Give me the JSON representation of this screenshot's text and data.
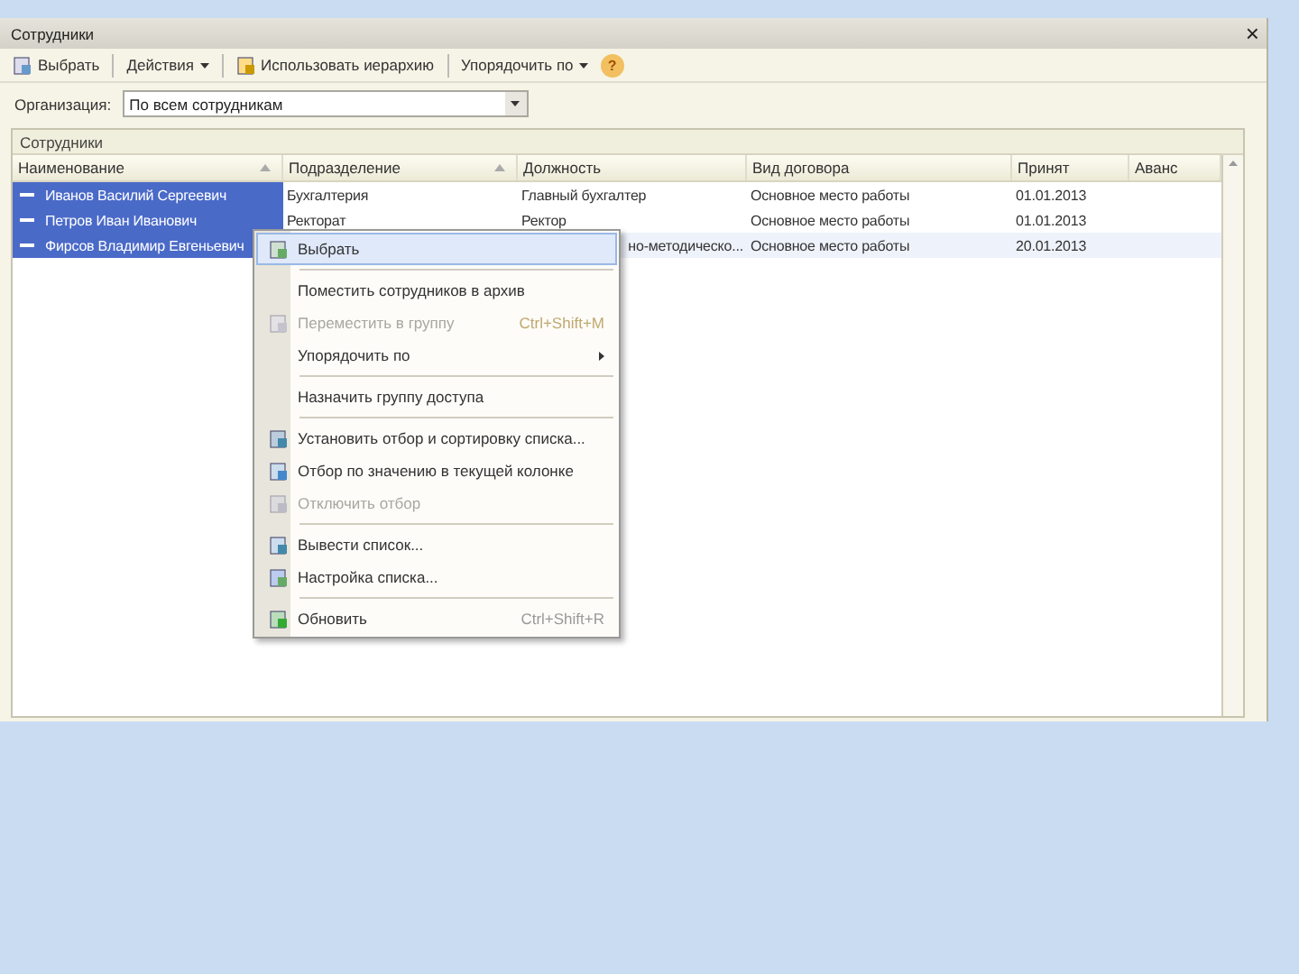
{
  "window": {
    "title": "Сотрудники",
    "close": "×"
  },
  "toolbar": [
    {
      "kind": "icon-button",
      "label": "Выбрать"
    },
    {
      "kind": "dropdown",
      "label": "Действия"
    },
    {
      "kind": "icon-button",
      "label": "Использовать иерархию"
    },
    {
      "kind": "dropdown",
      "label": "Упорядочить по"
    },
    {
      "kind": "help",
      "label": "?"
    }
  ],
  "filter": {
    "label": "Организация:",
    "value": "По всем сотрудникам"
  },
  "panel": {
    "title": "Сотрудники"
  },
  "table": {
    "columns": [
      {
        "label": "Наименование",
        "sortable": true
      },
      {
        "label": "Подразделение",
        "sortable": true
      },
      {
        "label": "Должность",
        "sortable": false
      },
      {
        "label": "Вид договора",
        "sortable": false
      },
      {
        "label": "Принят",
        "sortable": false
      },
      {
        "label": "Аванс",
        "sortable": false
      }
    ],
    "rows": [
      {
        "selected": true,
        "position_cut": false,
        "cells": [
          "Иванов Василий Сергеевич",
          "Бухгалтерия",
          "Главный бухгалтер",
          "Основное место работы",
          "01.01.2013",
          ""
        ]
      },
      {
        "selected": true,
        "position_cut": false,
        "cells": [
          "Петров Иван Иванович",
          "Ректорат",
          "Ректор",
          "Основное место работы",
          "01.01.2013",
          ""
        ]
      },
      {
        "selected": true,
        "position_cut": true,
        "cells": [
          "Фирсов Владимир Евгеньевич",
          "",
          "но-методическо...",
          "Основное место работы",
          "20.01.2013",
          ""
        ]
      }
    ]
  },
  "context_menu": [
    {
      "kind": "item",
      "label": "Выбрать",
      "selected": true,
      "disabled": false
    },
    {
      "kind": "separator"
    },
    {
      "kind": "item",
      "label": "Поместить сотрудников в архив",
      "selected": false,
      "disabled": false
    },
    {
      "kind": "item",
      "label": "Переместить в группу",
      "shortcut": "Ctrl+Shift+M",
      "selected": false,
      "disabled": true
    },
    {
      "kind": "submenu",
      "label": "Упорядочить по",
      "selected": false,
      "disabled": false
    },
    {
      "kind": "separator"
    },
    {
      "kind": "item",
      "label": "Назначить группу доступа",
      "selected": false,
      "disabled": false
    },
    {
      "kind": "separator"
    },
    {
      "kind": "item",
      "label": "Установить отбор и сортировку списка...",
      "selected": false,
      "disabled": false
    },
    {
      "kind": "item",
      "label": "Отбор по значению в текущей колонке",
      "selected": false,
      "disabled": false
    },
    {
      "kind": "item",
      "label": "Отключить отбор",
      "selected": false,
      "disabled": true
    },
    {
      "kind": "separator"
    },
    {
      "kind": "item",
      "label": "Вывести список...",
      "selected": false,
      "disabled": false
    },
    {
      "kind": "item",
      "label": "Настройка списка...",
      "selected": false,
      "disabled": false
    },
    {
      "kind": "separator"
    },
    {
      "kind": "item",
      "label": "Обновить",
      "shortcut": "Ctrl+Shift+R",
      "selected": false,
      "disabled": false
    }
  ]
}
